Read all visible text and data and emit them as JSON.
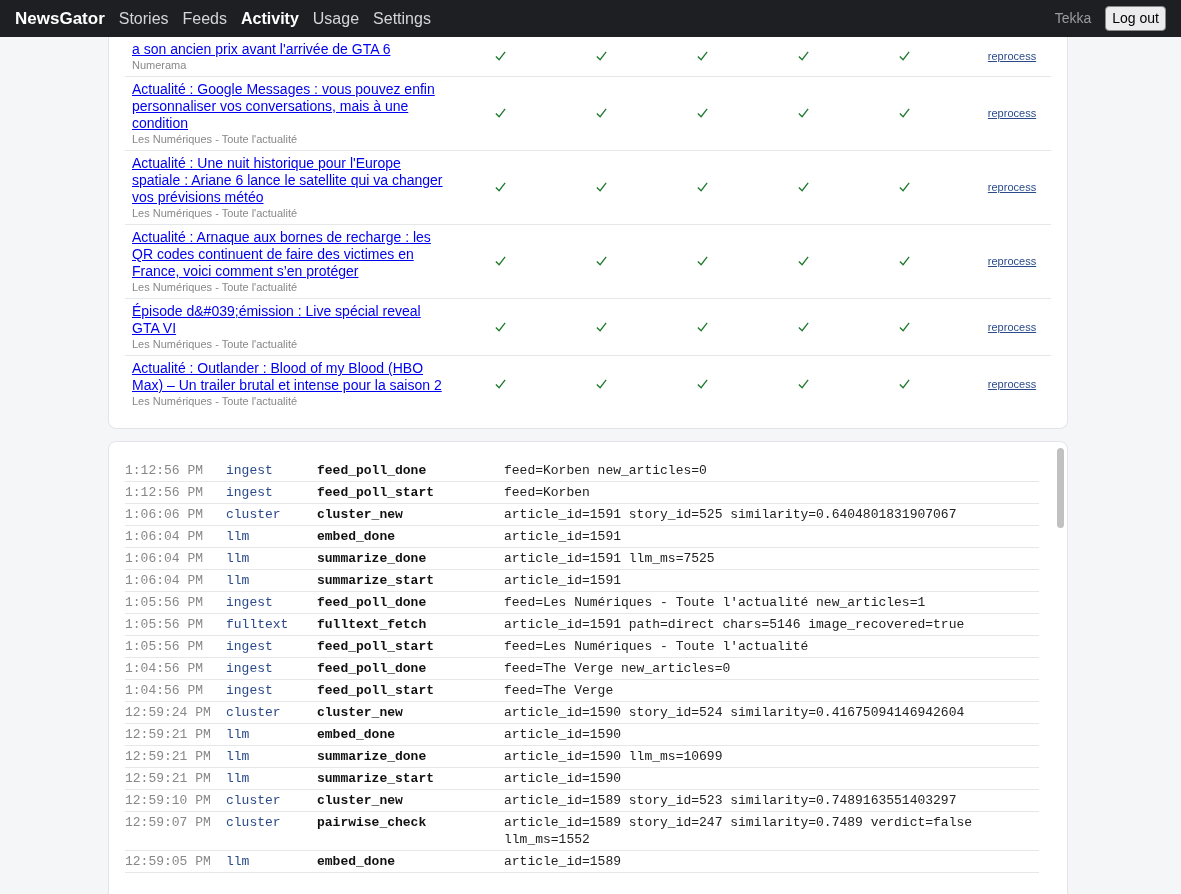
{
  "nav": {
    "brand": "NewsGator",
    "items": [
      {
        "label": "Stories",
        "selected": false
      },
      {
        "label": "Feeds",
        "selected": false
      },
      {
        "label": "Activity",
        "selected": true
      },
      {
        "label": "Usage",
        "selected": false
      },
      {
        "label": "Settings",
        "selected": false
      }
    ],
    "user": "Tekka",
    "logout": "Log out"
  },
  "articles": [
    {
      "title": "a son ancien prix avant l'arrivée de GTA 6",
      "source": "Numerama",
      "checks": [
        true,
        true,
        true,
        true,
        true
      ],
      "action": "reprocess"
    },
    {
      "title": "Actualité : Google Messages : vous pouvez enfin personnaliser vos conversations, mais à une condition",
      "source": "Les Numériques - Toute l'actualité",
      "checks": [
        true,
        true,
        true,
        true,
        true
      ],
      "action": "reprocess"
    },
    {
      "title": "Actualité : Une nuit historique pour l'Europe spatiale : Ariane 6 lance le satellite qui va changer vos prévisions météo",
      "source": "Les Numériques - Toute l'actualité",
      "checks": [
        true,
        true,
        true,
        true,
        true
      ],
      "action": "reprocess"
    },
    {
      "title": "Actualité : Arnaque aux bornes de recharge : les QR codes continuent de faire des victimes en France, voici comment s’en protéger",
      "source": "Les Numériques - Toute l'actualité",
      "checks": [
        true,
        true,
        true,
        true,
        true
      ],
      "action": "reprocess"
    },
    {
      "title": "Épisode d&#039;émission : Live spécial reveal GTA VI",
      "source": "Les Numériques - Toute l'actualité",
      "checks": [
        true,
        true,
        true,
        true,
        true
      ],
      "action": "reprocess"
    },
    {
      "title": "Actualité : Outlander : Blood of my Blood (HBO Max) – Un trailer brutal et intense pour la saison 2",
      "source": "Les Numériques - Toute l'actualité",
      "checks": [
        true,
        true,
        true,
        true,
        true
      ],
      "action": "reprocess"
    }
  ],
  "log": [
    {
      "time": "1:12:56 PM",
      "category": "ingest",
      "event": "feed_poll_done",
      "details": "feed=Korben new_articles=0"
    },
    {
      "time": "1:12:56 PM",
      "category": "ingest",
      "event": "feed_poll_start",
      "details": "feed=Korben"
    },
    {
      "time": "1:06:06 PM",
      "category": "cluster",
      "event": "cluster_new",
      "details": "article_id=1591 story_id=525 similarity=0.6404801831907067"
    },
    {
      "time": "1:06:04 PM",
      "category": "llm",
      "event": "embed_done",
      "details": "article_id=1591"
    },
    {
      "time": "1:06:04 PM",
      "category": "llm",
      "event": "summarize_done",
      "details": "article_id=1591 llm_ms=7525"
    },
    {
      "time": "1:06:04 PM",
      "category": "llm",
      "event": "summarize_start",
      "details": "article_id=1591"
    },
    {
      "time": "1:05:56 PM",
      "category": "ingest",
      "event": "feed_poll_done",
      "details": "feed=Les Numériques - Toute l'actualité new_articles=1"
    },
    {
      "time": "1:05:56 PM",
      "category": "fulltext",
      "event": "fulltext_fetch",
      "details": "article_id=1591 path=direct chars=5146 image_recovered=true"
    },
    {
      "time": "1:05:56 PM",
      "category": "ingest",
      "event": "feed_poll_start",
      "details": "feed=Les Numériques - Toute l'actualité"
    },
    {
      "time": "1:04:56 PM",
      "category": "ingest",
      "event": "feed_poll_done",
      "details": "feed=The Verge new_articles=0"
    },
    {
      "time": "1:04:56 PM",
      "category": "ingest",
      "event": "feed_poll_start",
      "details": "feed=The Verge"
    },
    {
      "time": "12:59:24 PM",
      "category": "cluster",
      "event": "cluster_new",
      "details": "article_id=1590 story_id=524 similarity=0.41675094146942604"
    },
    {
      "time": "12:59:21 PM",
      "category": "llm",
      "event": "embed_done",
      "details": "article_id=1590"
    },
    {
      "time": "12:59:21 PM",
      "category": "llm",
      "event": "summarize_done",
      "details": "article_id=1590 llm_ms=10699"
    },
    {
      "time": "12:59:21 PM",
      "category": "llm",
      "event": "summarize_start",
      "details": "article_id=1590"
    },
    {
      "time": "12:59:10 PM",
      "category": "cluster",
      "event": "cluster_new",
      "details": "article_id=1589 story_id=523 similarity=0.7489163551403297"
    },
    {
      "time": "12:59:07 PM",
      "category": "cluster",
      "event": "pairwise_check",
      "details": "article_id=1589 story_id=247 similarity=0.7489 verdict=false llm_ms=1552"
    },
    {
      "time": "12:59:05 PM",
      "category": "llm",
      "event": "embed_done",
      "details": "article_id=1589"
    }
  ]
}
